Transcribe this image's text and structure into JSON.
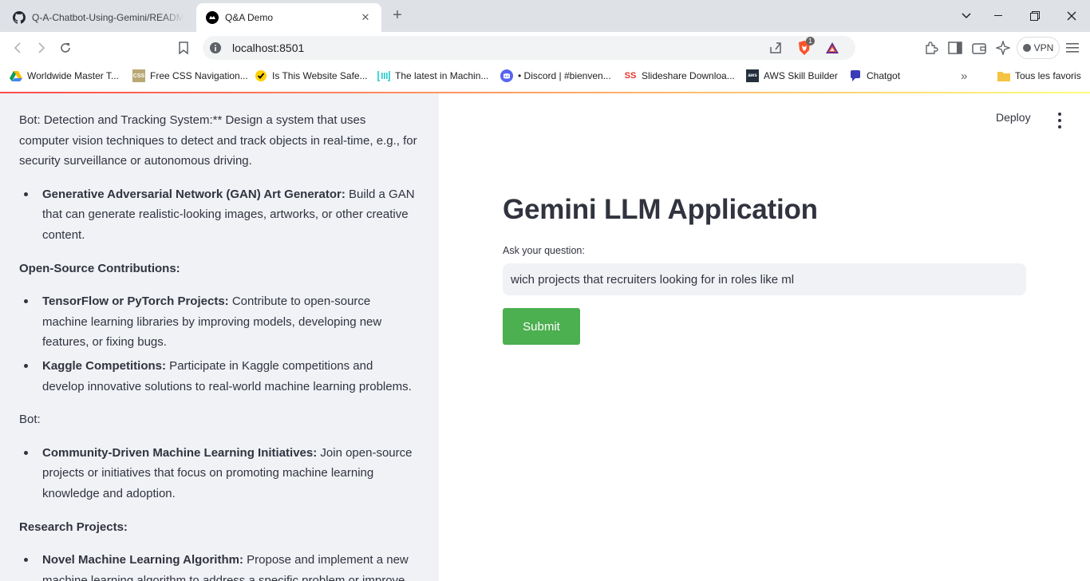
{
  "tabs": [
    {
      "title": "Q-A-Chatbot-Using-Gemini/README.md",
      "icon": "github-icon"
    },
    {
      "title": "Q&A Demo",
      "icon": "streamlit-icon"
    }
  ],
  "toolbar": {
    "url": "localhost:8501",
    "vpn_label": "VPN",
    "brave_badge": "1"
  },
  "bookmarks": [
    {
      "label": "Worldwide Master T...",
      "icon": "google-drive-icon"
    },
    {
      "label": "Free CSS Navigation...",
      "icon": "css-icon"
    },
    {
      "label": "Is This Website Safe...",
      "icon": "norton-check-icon"
    },
    {
      "label": "The latest in Machin...",
      "icon": "paperswithcode-icon"
    },
    {
      "label": "• Discord | #bienven...",
      "icon": "discord-icon"
    },
    {
      "label": "Slideshare Downloa...",
      "icon": "slideshare-icon"
    },
    {
      "label": "AWS Skill Builder",
      "icon": "aws-icon"
    },
    {
      "label": "Chatgot",
      "icon": "chat-icon"
    }
  ],
  "bookmarks_more": "»",
  "bookmarks_folder": "Tous les favoris",
  "sidebar": {
    "p1": "Bot: Detection and Tracking System:** Design a system that uses computer vision techniques to detect and track objects in real-time, e.g., for security surveillance or autonomous driving.",
    "li1_bold": "Generative Adversarial Network (GAN) Art Generator:",
    "li1_text": " Build a GAN that can generate realistic-looking images, artworks, or other creative content.",
    "h_open_source": "Open-Source Contributions:",
    "li2_bold": "TensorFlow or PyTorch Projects:",
    "li2_text": " Contribute to open-source machine learning libraries by improving models, developing new features, or fixing bugs.",
    "li3_bold": "Kaggle Competitions:",
    "li3_text": " Participate in Kaggle competitions and develop innovative solutions to real-world machine learning problems.",
    "p_bot": "Bot:",
    "li4_bold": "Community-Driven Machine Learning Initiatives:",
    "li4_text": " Join open-source projects or initiatives that focus on promoting machine learning knowledge and adoption.",
    "h_research": "Research Projects:",
    "li5_bold": "Novel Machine Learning Algorithm:",
    "li5_text": " Propose and implement a new machine learning algorithm to address a specific problem or improve"
  },
  "main": {
    "deploy_label": "Deploy",
    "title": "Gemini LLM Application",
    "input_label": "Ask your question:",
    "input_value": "wich projects that recruiters looking for in roles like ml",
    "submit_label": "Submit"
  },
  "colors": {
    "submit_bg": "#4caf50",
    "sidebar_bg": "#f0f2f6",
    "input_bg": "#f0f2f6",
    "text": "#31333f"
  }
}
